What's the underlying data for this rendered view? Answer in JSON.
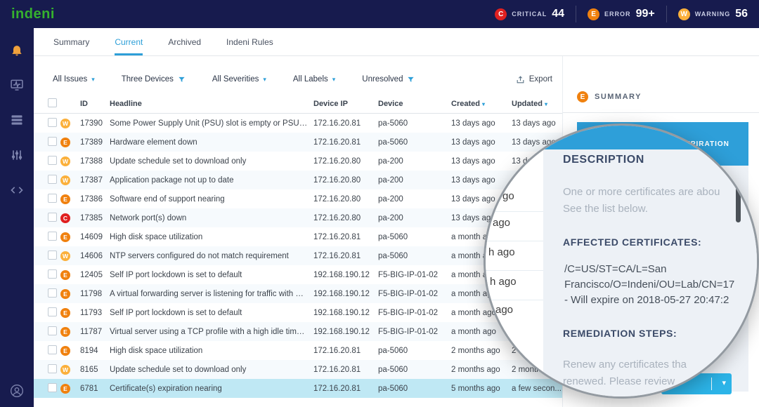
{
  "topbar": {
    "logo": "indeni",
    "badges": [
      {
        "letter": "C",
        "label": "CRITICAL",
        "count": "44"
      },
      {
        "letter": "E",
        "label": "ERROR",
        "count": "99+"
      },
      {
        "letter": "W",
        "label": "WARNING",
        "count": "56"
      }
    ]
  },
  "tabs": [
    {
      "label": "Summary"
    },
    {
      "label": "Current"
    },
    {
      "label": "Archived"
    },
    {
      "label": "Indeni Rules"
    }
  ],
  "filters": {
    "issues": "All Issues",
    "devices": "Three Devices",
    "severities": "All Severities",
    "labels": "All Labels",
    "resolution": "Unresolved",
    "export_label": "Export"
  },
  "table": {
    "columns": {
      "id": "ID",
      "headline": "Headline",
      "ip": "Device IP",
      "device": "Device",
      "created": "Created",
      "updated": "Updated"
    },
    "rows": [
      {
        "severity": "W",
        "id": "17390",
        "headline": "Some Power Supply Unit (PSU) slot is empty or PSU is down",
        "ip": "172.16.20.81",
        "device": "pa-5060",
        "created": "13 days ago",
        "updated": "13 days ago"
      },
      {
        "severity": "E",
        "id": "17389",
        "headline": "Hardware element down",
        "ip": "172.16.20.81",
        "device": "pa-5060",
        "created": "13 days ago",
        "updated": "13 days ago"
      },
      {
        "severity": "W",
        "id": "17388",
        "headline": "Update schedule set to download only",
        "ip": "172.16.20.80",
        "device": "pa-200",
        "created": "13 days ago",
        "updated": "13 days ago"
      },
      {
        "severity": "W",
        "id": "17387",
        "headline": "Application package not up to date",
        "ip": "172.16.20.80",
        "device": "pa-200",
        "created": "13 days ago",
        "updated": ""
      },
      {
        "severity": "E",
        "id": "17386",
        "headline": "Software end of support nearing",
        "ip": "172.16.20.80",
        "device": "pa-200",
        "created": "13 days ago",
        "updated": ""
      },
      {
        "severity": "C",
        "id": "17385",
        "headline": "Network port(s) down",
        "ip": "172.16.20.80",
        "device": "pa-200",
        "created": "13 days ago",
        "updated": ""
      },
      {
        "severity": "E",
        "id": "14609",
        "headline": "High disk space utilization",
        "ip": "172.16.20.81",
        "device": "pa-5060",
        "created": "a month ago",
        "updated": ""
      },
      {
        "severity": "W",
        "id": "14606",
        "headline": "NTP servers configured do not match requirement",
        "ip": "172.16.20.81",
        "device": "pa-5060",
        "created": "a month ago",
        "updated": ""
      },
      {
        "severity": "E",
        "id": "12405",
        "headline": "Self IP port lockdown is set to default",
        "ip": "192.168.190.12",
        "device": "F5-BIG-IP-01-02",
        "created": "a month ago",
        "updated": ""
      },
      {
        "severity": "E",
        "id": "11798",
        "headline": "A virtual forwarding server is listening for traffic with a destinati...",
        "ip": "192.168.190.12",
        "device": "F5-BIG-IP-01-02",
        "created": "a month ago",
        "updated": ""
      },
      {
        "severity": "E",
        "id": "11793",
        "headline": "Self IP port lockdown is set to default",
        "ip": "192.168.190.12",
        "device": "F5-BIG-IP-01-02",
        "created": "a month ago",
        "updated": ""
      },
      {
        "severity": "E",
        "id": "11787",
        "headline": "Virtual server using a TCP profile with a high idle timeout",
        "ip": "192.168.190.12",
        "device": "F5-BIG-IP-01-02",
        "created": "a month ago",
        "updated": ""
      },
      {
        "severity": "E",
        "id": "8194",
        "headline": "High disk space utilization",
        "ip": "172.16.20.81",
        "device": "pa-5060",
        "created": "2 months ago",
        "updated": "2 m"
      },
      {
        "severity": "W",
        "id": "8165",
        "headline": "Update schedule set to download only",
        "ip": "172.16.20.81",
        "device": "pa-5060",
        "created": "2 months ago",
        "updated": "2 month"
      },
      {
        "severity": "E",
        "id": "6781",
        "headline": "Certificate(s) expiration nearing",
        "ip": "172.16.20.81",
        "device": "pa-5060",
        "created": "5 months ago",
        "updated": "a few secon...",
        "selected": true
      }
    ]
  },
  "panel": {
    "title": "SUMMARY",
    "severity_letter": "E",
    "card_title": "CERTIFICATE(S) EXPIRATION"
  },
  "magnifier": {
    "fragments": [
      "go",
      "ago",
      "h ago",
      "h ago",
      "ago"
    ],
    "description_heading": "DESCRIPTION",
    "description_line1": "One or more certificates are abou",
    "description_line2": "See the list below.",
    "affected_heading": "AFFECTED CERTIFICATES:",
    "cert_line1": "/C=US/ST=CA/L=San",
    "cert_line2": "Francisco/O=Indeni/OU=Lab/CN=17",
    "cert_line3": "- Will expire on 2018-05-27 20:47:2",
    "remediation_heading": "REMEDIATION STEPS:",
    "remediation_line1": "Renew any certificates tha",
    "remediation_line2": "renewed. Please review"
  },
  "colors": {
    "navy": "#171b4e",
    "accent_blue": "#2d9fd8",
    "critical": "#e02020",
    "error": "#f0810f",
    "warning": "#fbb03b",
    "selected_row": "#bfe8f4",
    "card_header_blue": "#2e9fd9",
    "action_button_blue": "#2cb4e8",
    "logo_green": "#35b12e"
  }
}
